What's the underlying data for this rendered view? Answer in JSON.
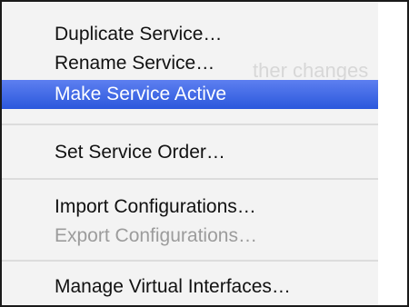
{
  "menu": {
    "items": [
      {
        "label": "Duplicate Service…",
        "state": "normal"
      },
      {
        "label": "Rename Service…",
        "state": "normal"
      },
      {
        "label": "Make Service Active",
        "state": "highlighted"
      },
      {
        "label": "Set Service Order…",
        "state": "normal"
      },
      {
        "label": "Import Configurations…",
        "state": "normal"
      },
      {
        "label": "Export Configurations…",
        "state": "disabled"
      },
      {
        "label": "Manage Virtual Interfaces…",
        "state": "normal"
      }
    ]
  },
  "background": {
    "partial_text": "ther changes"
  },
  "colors": {
    "highlight_top": "#5d7ff0",
    "highlight_bottom": "#2b58dc",
    "disabled_text": "#9c9c9c",
    "menu_bg": "#f3f3f3"
  }
}
